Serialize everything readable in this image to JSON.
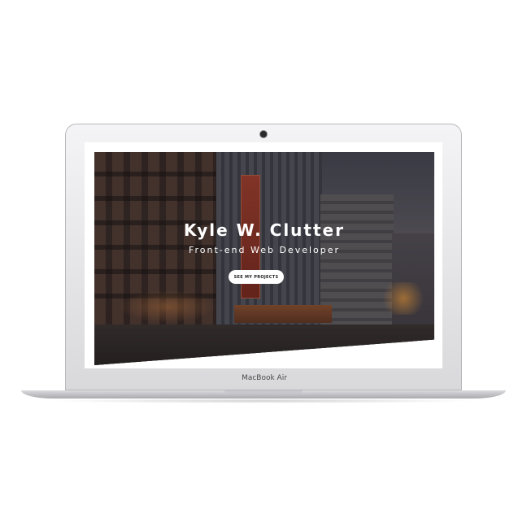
{
  "device": {
    "model_label": "MacBook Air"
  },
  "hero": {
    "name": "Kyle W. Clutter",
    "role": "Front-end Web Developer",
    "cta_label": "SEE MY PROJECTS",
    "background": "city-street-photo"
  },
  "colors": {
    "overlay": "#19161a",
    "cta_background": "#ffffff",
    "text": "#ffffff"
  }
}
